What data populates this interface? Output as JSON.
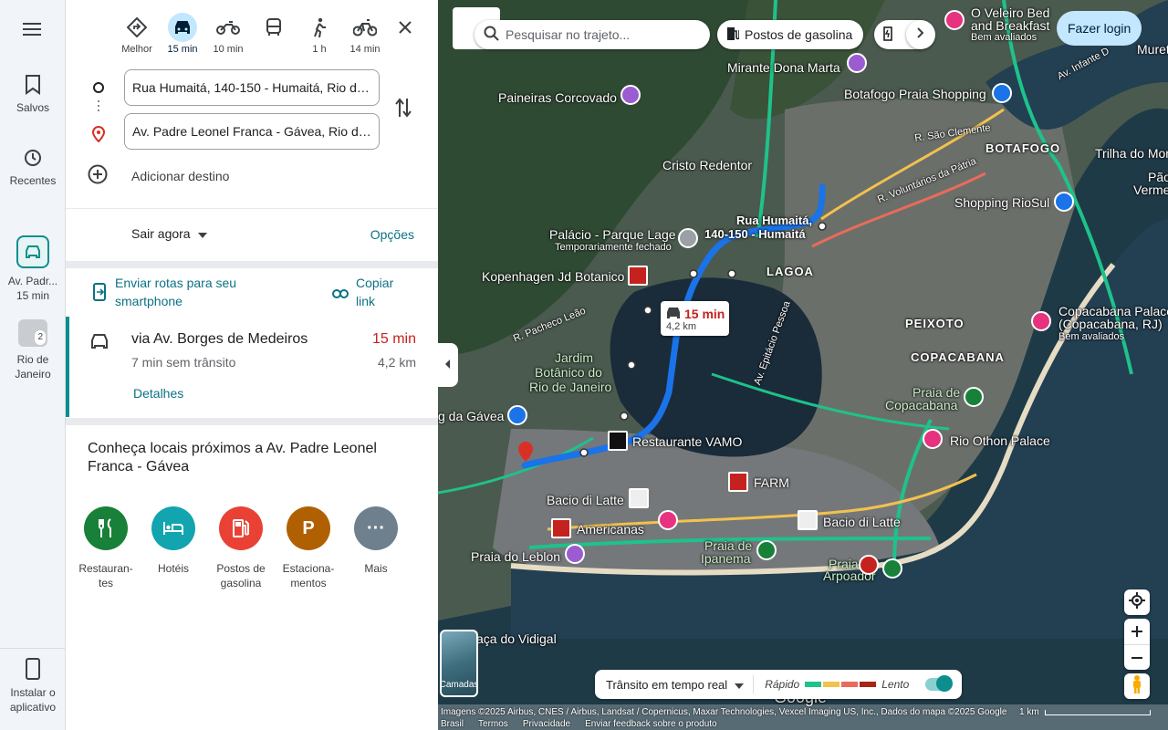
{
  "rail": {
    "menu_icon": "menu-icon",
    "saved": "Salvos",
    "recents": "Recentes",
    "active_route_line1": "Av. Padr...",
    "active_route_line2": "15 min",
    "place_line1": "Rio de",
    "place_line2": "Janeiro",
    "place_badge": "2",
    "install": "Instalar o aplicativo"
  },
  "modes": [
    {
      "name": "best",
      "label": "Melhor"
    },
    {
      "name": "car",
      "label": "15 min"
    },
    {
      "name": "moto",
      "label": "10 min"
    },
    {
      "name": "transit",
      "label": ""
    },
    {
      "name": "walk",
      "label": "1 h"
    },
    {
      "name": "bike",
      "label": "14 min"
    }
  ],
  "inputs": {
    "origin": "Rua Humaitá, 140-150 - Humaitá, Rio de Janeiro",
    "destination": "Av. Padre Leonel Franca - Gávea, Rio de Janeiro",
    "add_destination": "Adicionar destino"
  },
  "depart": {
    "label": "Sair agora",
    "options": "Opções"
  },
  "share": {
    "send": "Enviar rotas para seu smartphone",
    "copy": "Copiar link"
  },
  "route": {
    "via": "via Av. Borges de Medeiros",
    "time": "15 min",
    "no_traffic": "7 min sem trânsito",
    "distance": "4,2 km",
    "details": "Detalhes"
  },
  "nearby": {
    "title": "Conheça locais próximos a Av. Padre Leonel Franca - Gávea",
    "items": [
      {
        "label": "Restauran-tes",
        "color": "#188038"
      },
      {
        "label": "Hotéis",
        "color": "#12a4af"
      },
      {
        "label": "Postos de gasolina",
        "color": "#e94235"
      },
      {
        "label": "Estaciona-mentos",
        "color": "#b06000"
      },
      {
        "label": "Mais",
        "color": "#6e7f8d"
      }
    ]
  },
  "map": {
    "search_placeholder": "Pesquisar no trajeto...",
    "chip_gas": "Postos de gasolina",
    "login": "Fazer login",
    "route_badge_time": "15 min",
    "route_badge_dist": "4,2 km",
    "layers": "Camadas",
    "traffic": {
      "label": "Trânsito em tempo real",
      "fast": "Rápido",
      "slow": "Lento",
      "colors": [
        "#1ec28b",
        "#f2c14e",
        "#ea6b5a",
        "#a52714"
      ]
    },
    "labels": {
      "veleiro": "O Veleiro Bed",
      "veleiro2": "and Breakfast",
      "bem_avaliados": "Bem avaliados",
      "infante": "Av. Infante D",
      "mureta": "Muret",
      "mirante": "Mirante Dona Marta",
      "paineiras": "Paineiras Corcovado",
      "botafogo_shop": "Botafogo Praia Shopping",
      "sao_clemente": "R. São Clemente",
      "botafogo": "BOTAFOGO",
      "trilha": "Trilha do Morro",
      "pao": "Pão",
      "vermelh": "Vermelh",
      "cristo": "Cristo Redentor",
      "voluntarios": "R. Voluntários da Pátria",
      "riosul": "Shopping RioSul",
      "palacio": "Palácio - Parque Lage",
      "temp_fechado": "Temporariamente fechado",
      "humaita1": "Rua Humaitá,",
      "humaita2": "140-150 - Humaitá",
      "kopenhagen": "Kopenhagen Jd Botanico",
      "lagoa": "LAGOA",
      "pacheco": "R. Pacheco Leão",
      "copa_palace": "Copacabana Palace",
      "copa_palace2": "(Copacabana, RJ)",
      "bem_avaliados2": "Bem avaliados",
      "peixoto": "PEIXOTO",
      "copacabana": "COPACABANA",
      "epitacio": "Av. Epitácio Pessoa",
      "jardim": "Jardim",
      "botanico": "Botânico do",
      "rio_janeiro": "Rio de Janeiro",
      "gavea": "g da Gávea",
      "praia_copa": "Praia de",
      "praia_copa2": "Copacabana",
      "vamo": "Restaurante VAMO",
      "othon": "Rio Othon Palace",
      "farm": "FARM",
      "bacio1": "Bacio di Latte",
      "bacio2": "Bacio di Latte",
      "americanas": "Americanas",
      "leblon": "Praia do Leblon",
      "ipanema": "Praia de",
      "ipanema2": "Ipanema",
      "arpoador": "Praia",
      "arpoador2": "Arpoador",
      "vidigal": "aça do Vidigal",
      "google": "Google"
    },
    "footer": {
      "imagery": "Imagens ©2025 Airbus, CNES / Airbus, Landsat / Copernicus, Maxar Technologies, Vexcel Imaging US, Inc., Dados do mapa ©2025 Google",
      "country": "Brasil",
      "terms": "Termos",
      "privacy": "Privacidade",
      "feedback": "Enviar feedback sobre o produto",
      "scale": "1 km"
    }
  }
}
